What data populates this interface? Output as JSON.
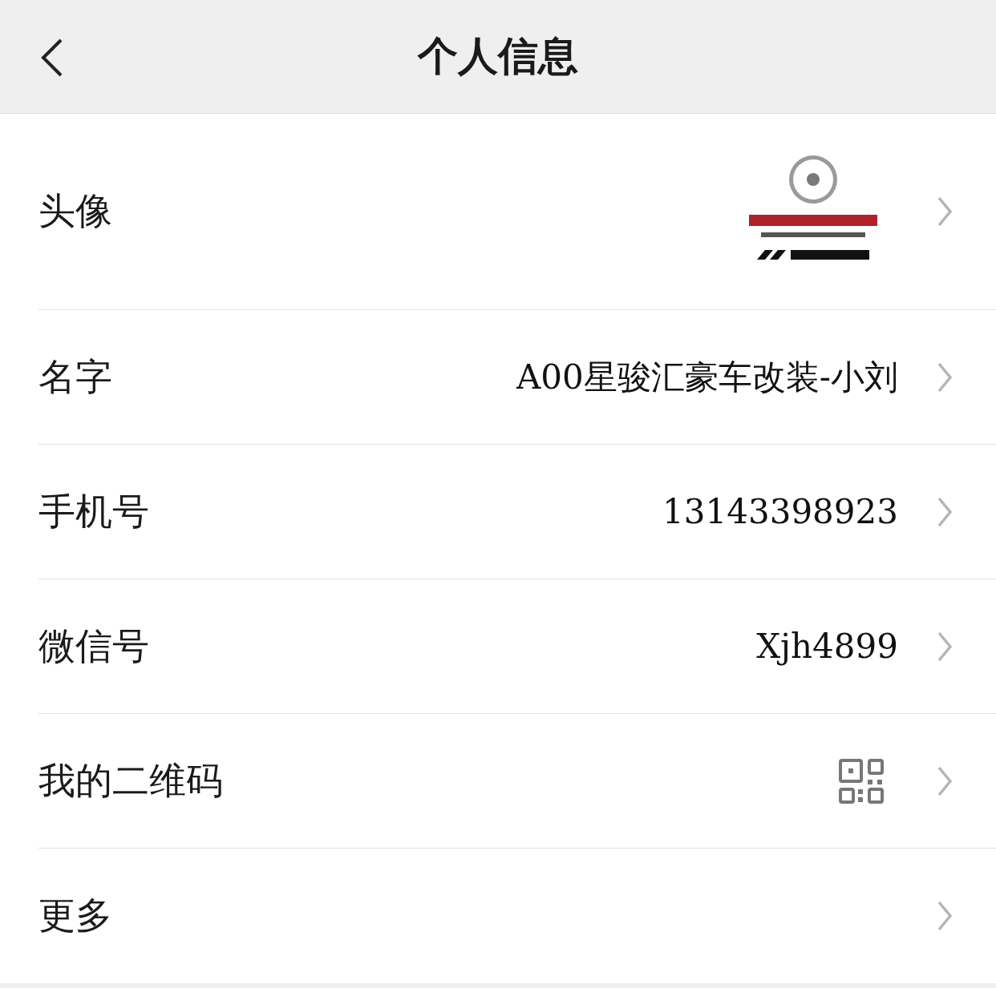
{
  "header": {
    "title": "个人信息"
  },
  "rows": [
    {
      "kind": "avatar",
      "label": "头像"
    },
    {
      "kind": "text",
      "label": "名字",
      "value": "A00星骏汇豪车改装-小刘"
    },
    {
      "kind": "text",
      "label": "手机号",
      "value": "13143398923"
    },
    {
      "kind": "text",
      "label": "微信号",
      "value": "Xjh4899"
    },
    {
      "kind": "qr",
      "label": "我的二维码"
    },
    {
      "kind": "plain",
      "label": "更多"
    }
  ]
}
